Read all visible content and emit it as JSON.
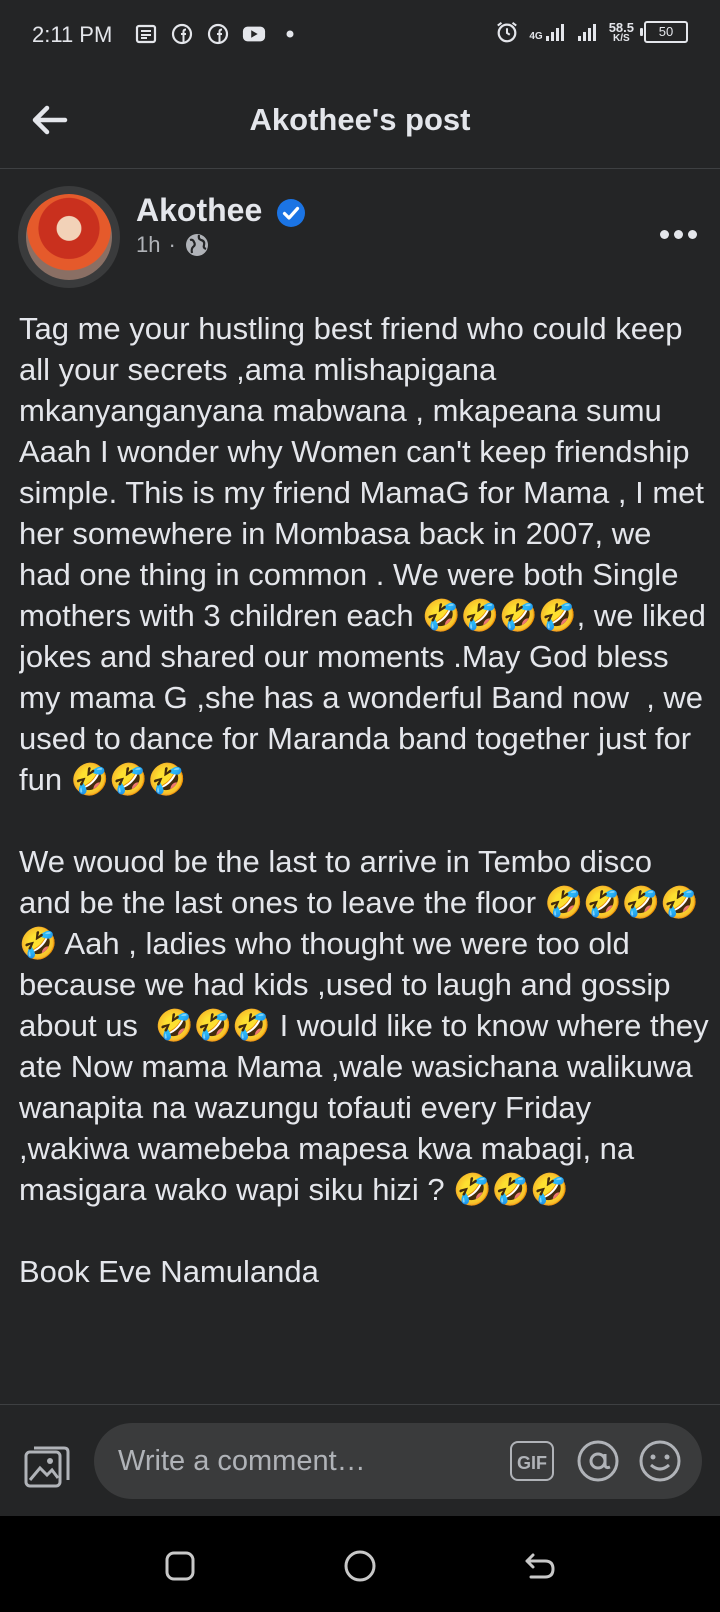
{
  "status_bar": {
    "time": "2:11 PM",
    "network": "4G",
    "speed_value": "58.5",
    "speed_unit": "K/S",
    "battery": "50"
  },
  "header": {
    "title": "Akothee's post"
  },
  "post": {
    "author": "Akothee",
    "time_ago": "1h",
    "separator": "·",
    "paragraphs": [
      "Tag me your hustling best friend who could keep all your secrets ,ama mlishapigana mkanyanganyana mabwana , mkapeana sumu\nAaah I wonder why Women can't keep friendship simple. This is my friend MamaG for Mama , I met her somewhere in Mombasa back in 2007, we had one thing in common . We were both Single mothers with 3 children each 🤣🤣🤣🤣, we liked jokes and shared our moments .May God bless my mama G ,she has a wonderful Band now  , we used to dance for Maranda band together just for fun 🤣🤣🤣",
      "We wouod be the last to arrive in Tembo disco and be the last ones to leave the floor 🤣🤣🤣🤣🤣 Aah , ladies who thought we were too old because we had kids ,used to laugh and gossip about us  🤣🤣🤣 I would like to know where they ate Now mama Mama ,wale wasichana walikuwa wanapita na wazungu tofauti every Friday  ,wakiwa wamebeba mapesa kwa mabagi, na masigara wako wapi siku hizi ? 🤣🤣🤣",
      "Book Eve Namulanda"
    ]
  },
  "comment_bar": {
    "placeholder": "Write a comment…",
    "gif_label": "GIF"
  },
  "colors": {
    "background": "#242526",
    "text": "#e4e6eb",
    "muted": "#b0b3b8",
    "verified": "#1b74e4",
    "input_bg": "#3a3b3c"
  }
}
